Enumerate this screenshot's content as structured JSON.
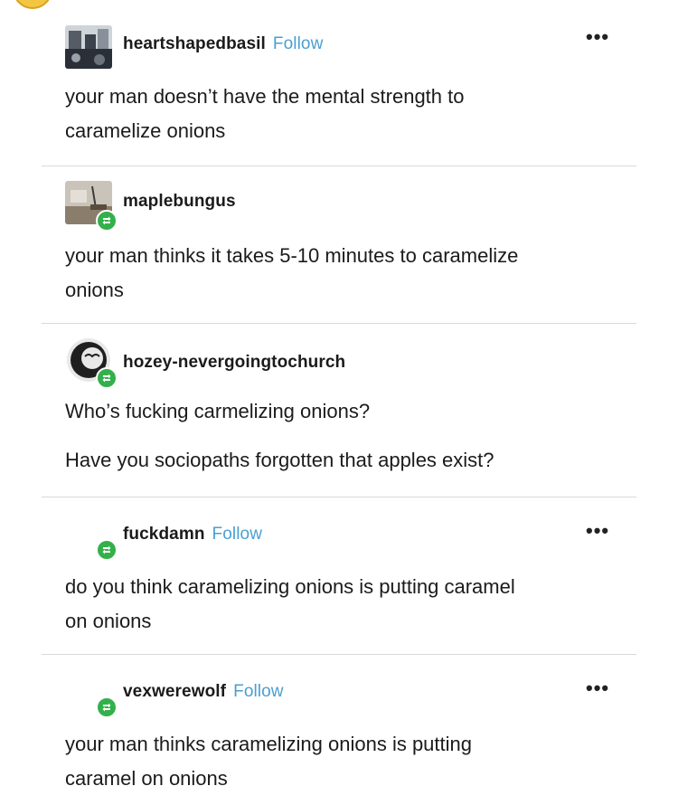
{
  "posts": [
    {
      "username": "heartshapedbasil",
      "follow_label": "Follow",
      "more_label": "•••",
      "lines": [
        "your man doesn’t have the mental strength to",
        "caramelize onions"
      ]
    },
    {
      "username": "maplebungus",
      "lines": [
        "your man thinks it takes 5-10 minutes to caramelize",
        "onions"
      ]
    },
    {
      "username": "hozey-nevergoingtochurch",
      "lines": [
        "Who’s fucking carmelizing onions?",
        "Have you sociopaths forgotten that apples exist?"
      ]
    },
    {
      "username": "fuckdamn",
      "follow_label": "Follow",
      "more_label": "•••",
      "lines": [
        "do you think caramelizing onions is putting caramel",
        "on onions"
      ]
    },
    {
      "username": "vexwerewolf",
      "follow_label": "Follow",
      "more_label": "•••",
      "lines": [
        "your man thinks caramelizing onions is putting",
        "caramel on onions"
      ]
    }
  ],
  "colors": {
    "follow": "#4a9fd1",
    "reblog_badge": "#33b04a",
    "divider": "#d9d9d9",
    "text": "#1b1b1b"
  },
  "icons": {
    "reblog": "reblog-icon",
    "more": "more-options-icon"
  }
}
